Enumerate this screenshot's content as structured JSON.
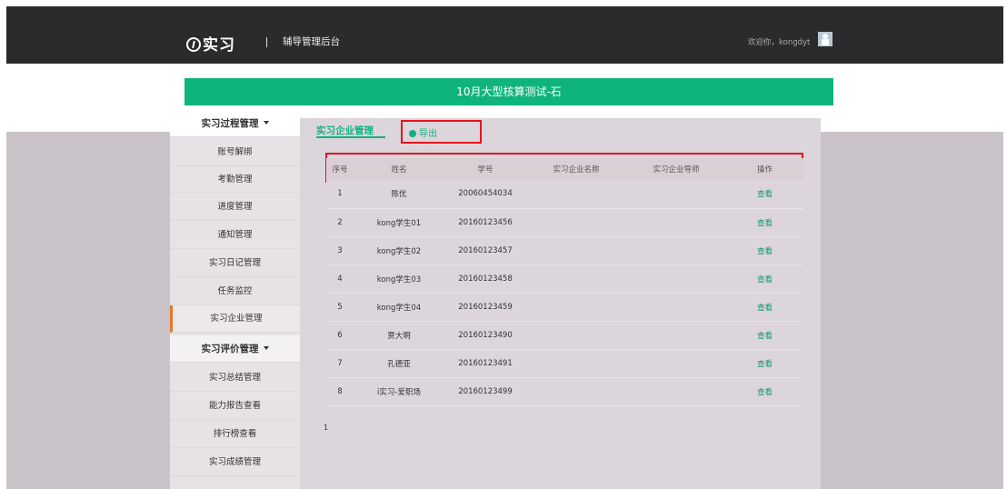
{
  "header": {
    "logo_text": "实习",
    "system_title": "辅导管理后台",
    "welcome": "欢迎你，kongdyt"
  },
  "banner": {
    "title": "10月大型核算测试-石"
  },
  "sidebar": {
    "group1_label": "实习过程管理",
    "items": [
      {
        "label": "账号解绑"
      },
      {
        "label": "考勤管理"
      },
      {
        "label": "进度管理"
      },
      {
        "label": "通知管理"
      },
      {
        "label": "实习日记管理"
      },
      {
        "label": "任务监控"
      },
      {
        "label": "实习企业管理"
      }
    ],
    "group2_label": "实习评价管理",
    "items2": [
      {
        "label": "实习总结管理"
      },
      {
        "label": "能力报告查看"
      },
      {
        "label": "排行榜查看"
      },
      {
        "label": "实习成绩管理"
      }
    ]
  },
  "main": {
    "breadcrumb": "实习企业管理",
    "export_label": "导出",
    "columns": [
      "序号",
      "姓名",
      "学号",
      "实习企业名称",
      "实习企业导师",
      "操作"
    ],
    "rows": [
      {
        "no": "1",
        "name": "陈优",
        "id": "20060454034",
        "company": "",
        "mentor": "",
        "action": "查看"
      },
      {
        "no": "2",
        "name": "kong学生01",
        "id": "20160123456",
        "company": "",
        "mentor": "",
        "action": "查看"
      },
      {
        "no": "3",
        "name": "kong学生02",
        "id": "20160123457",
        "company": "",
        "mentor": "",
        "action": "查看"
      },
      {
        "no": "4",
        "name": "kong学生03",
        "id": "20160123458",
        "company": "",
        "mentor": "",
        "action": "查看"
      },
      {
        "no": "5",
        "name": "kong学生04",
        "id": "20160123459",
        "company": "",
        "mentor": "",
        "action": "查看"
      },
      {
        "no": "6",
        "name": "贾大明",
        "id": "20160123490",
        "company": "",
        "mentor": "",
        "action": "查看"
      },
      {
        "no": "7",
        "name": "孔德亚",
        "id": "20160123491",
        "company": "",
        "mentor": "",
        "action": "查看"
      },
      {
        "no": "8",
        "name": "i实习-爱职场",
        "id": "20160123499",
        "company": "",
        "mentor": "",
        "action": "查看"
      }
    ],
    "page_number": "1"
  },
  "colors": {
    "accent": "#0fb47d",
    "highlight": "#e3141c",
    "header_bg": "#2b2b2b",
    "active_marker": "#e07b24"
  }
}
